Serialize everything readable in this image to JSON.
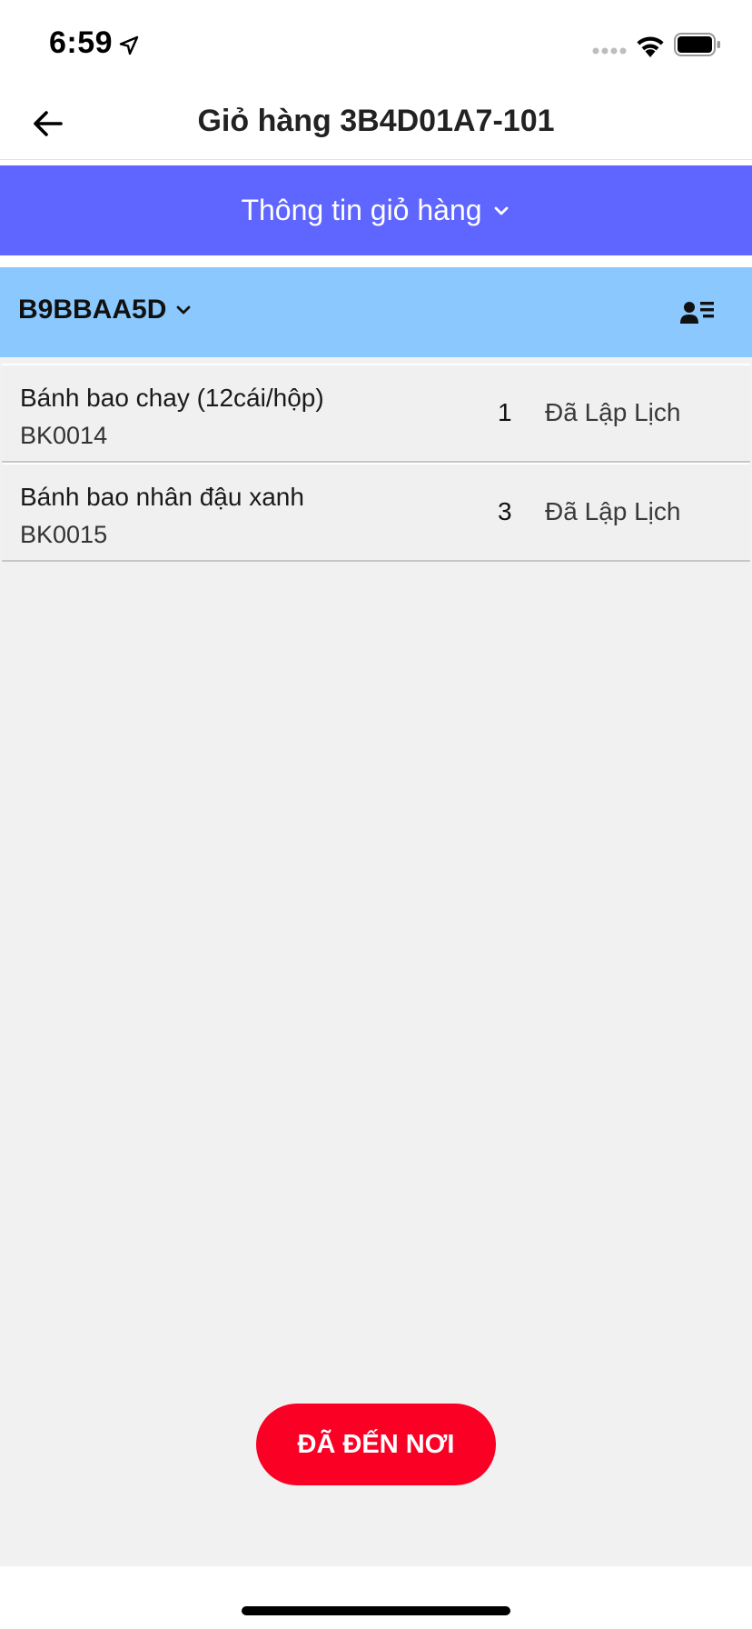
{
  "status_bar": {
    "time": "6:59"
  },
  "nav": {
    "title": "Giỏ hàng 3B4D01A7-101",
    "back_icon": "arrow-left-icon"
  },
  "cart_info": {
    "label": "Thông tin giỏ hàng",
    "background": "#5f66ff"
  },
  "customer": {
    "code": "B9BBAA5D",
    "background": "#8ac8fd",
    "list_icon": "user-list-icon"
  },
  "items": [
    {
      "name": "Bánh bao chay (12cái/hộp)",
      "code": "BK0014",
      "quantity": "1",
      "status": "Đã Lập Lịch"
    },
    {
      "name": "Bánh bao nhân đậu xanh",
      "code": "BK0015",
      "quantity": "3",
      "status": "Đã Lập Lịch"
    }
  ],
  "action": {
    "label": "ĐÃ ĐẾN NƠI",
    "color": "#fa0025"
  }
}
